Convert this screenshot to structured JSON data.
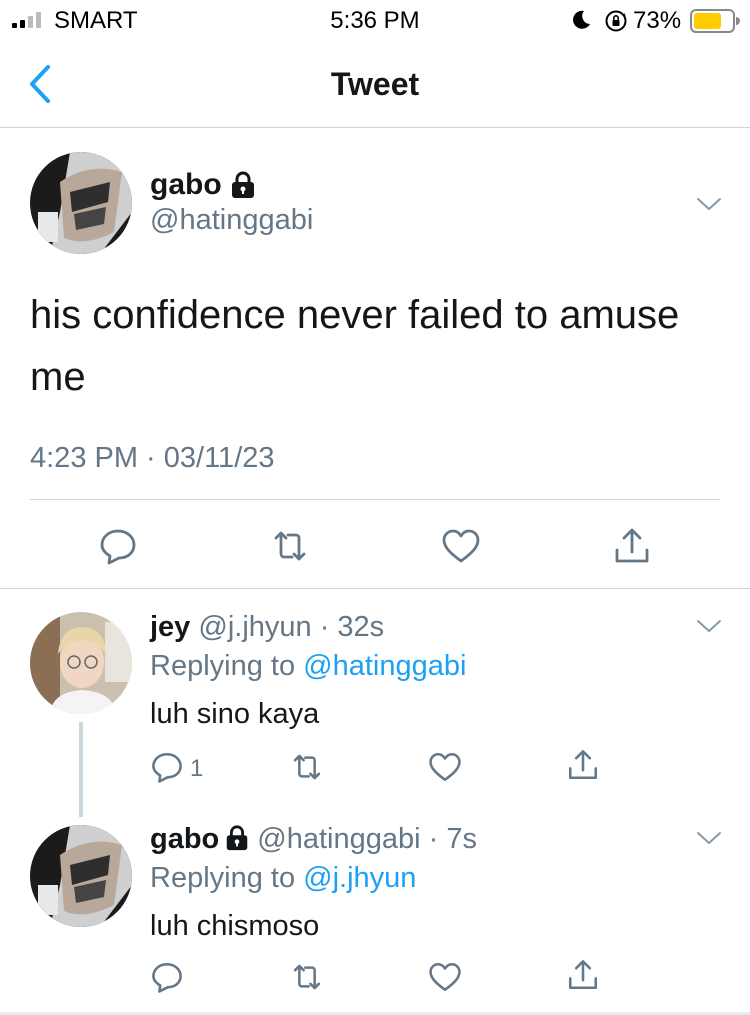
{
  "status_bar": {
    "carrier": "SMART",
    "time": "5:36 PM",
    "battery_percent": "73%",
    "battery_level": 0.73,
    "icons": [
      "signal-icon",
      "moon-icon",
      "rotation-lock-icon",
      "battery-icon"
    ]
  },
  "nav": {
    "back_icon": "chevron-left-icon",
    "title": "Tweet"
  },
  "main_tweet": {
    "name": "gabo",
    "protected_icon": "lock-icon",
    "handle": "@hatinggabi",
    "text": "his confidence never failed to amuse me",
    "timestamp": "4:23 PM · 03/11/23",
    "actions": [
      "reply-icon",
      "retweet-icon",
      "like-icon",
      "share-icon"
    ]
  },
  "replies": [
    {
      "name": "jey",
      "handle_time": "@j.jhyun · 32s",
      "replying_prefix": "Replying to",
      "replying_to": "@hatinggabi",
      "text": "luh sino kaya",
      "reply_count": "1"
    },
    {
      "name": "gabo",
      "handle_time": "@hatinggabi · 7s",
      "replying_prefix": "Replying to",
      "replying_to": "@j.jhyun",
      "text": "luh chismoso",
      "reply_count": ""
    }
  ],
  "colors": {
    "accent": "#1da1f2",
    "text_primary": "#14171a",
    "text_secondary": "#657786",
    "border": "#ccd6dd",
    "battery": "#ffcc00"
  }
}
